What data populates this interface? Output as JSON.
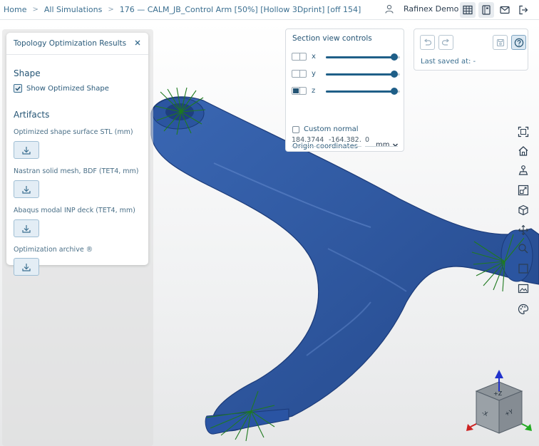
{
  "breadcrumbs": {
    "home": "Home",
    "all_simulations": "All Simulations",
    "current": "176 — CALM_JB_Control Arm [50%] [Hollow 3Dprint] [off 154]"
  },
  "user": {
    "name": "Rafinex Demo"
  },
  "panel": {
    "title": "Topology Optimization Results",
    "shape_heading": "Shape",
    "show_optimized_label": "Show Optimized Shape",
    "show_optimized_checked": true,
    "artifacts_heading": "Artifacts",
    "artifacts": [
      {
        "label": "Optimized shape surface STL (mm)"
      },
      {
        "label": "Nastran solid mesh, BDF (TET4, mm)"
      },
      {
        "label": "Abaqus modal INP deck (TET4, mm)"
      },
      {
        "label": "Optimization archive ®"
      }
    ]
  },
  "section_view": {
    "title": "Section view controls",
    "axes": [
      {
        "letter": "x",
        "enabled": false,
        "value_pct": 92
      },
      {
        "letter": "y",
        "enabled": false,
        "value_pct": 92
      },
      {
        "letter": "z",
        "enabled": true,
        "value_pct": 92
      }
    ],
    "custom_normal_label": "Custom normal",
    "origin_label": "Origin coordinates",
    "unit": "mm",
    "coords": [
      "184.3744…",
      "-164.382…",
      "0"
    ]
  },
  "save": {
    "last_saved": "Last saved at: -"
  },
  "view_cube": {
    "front": "-X",
    "right": "+Y",
    "top": "+Z"
  },
  "colors": {
    "accent": "#245474",
    "model": "#2f58a0",
    "arrows": "#1f7a1f"
  }
}
